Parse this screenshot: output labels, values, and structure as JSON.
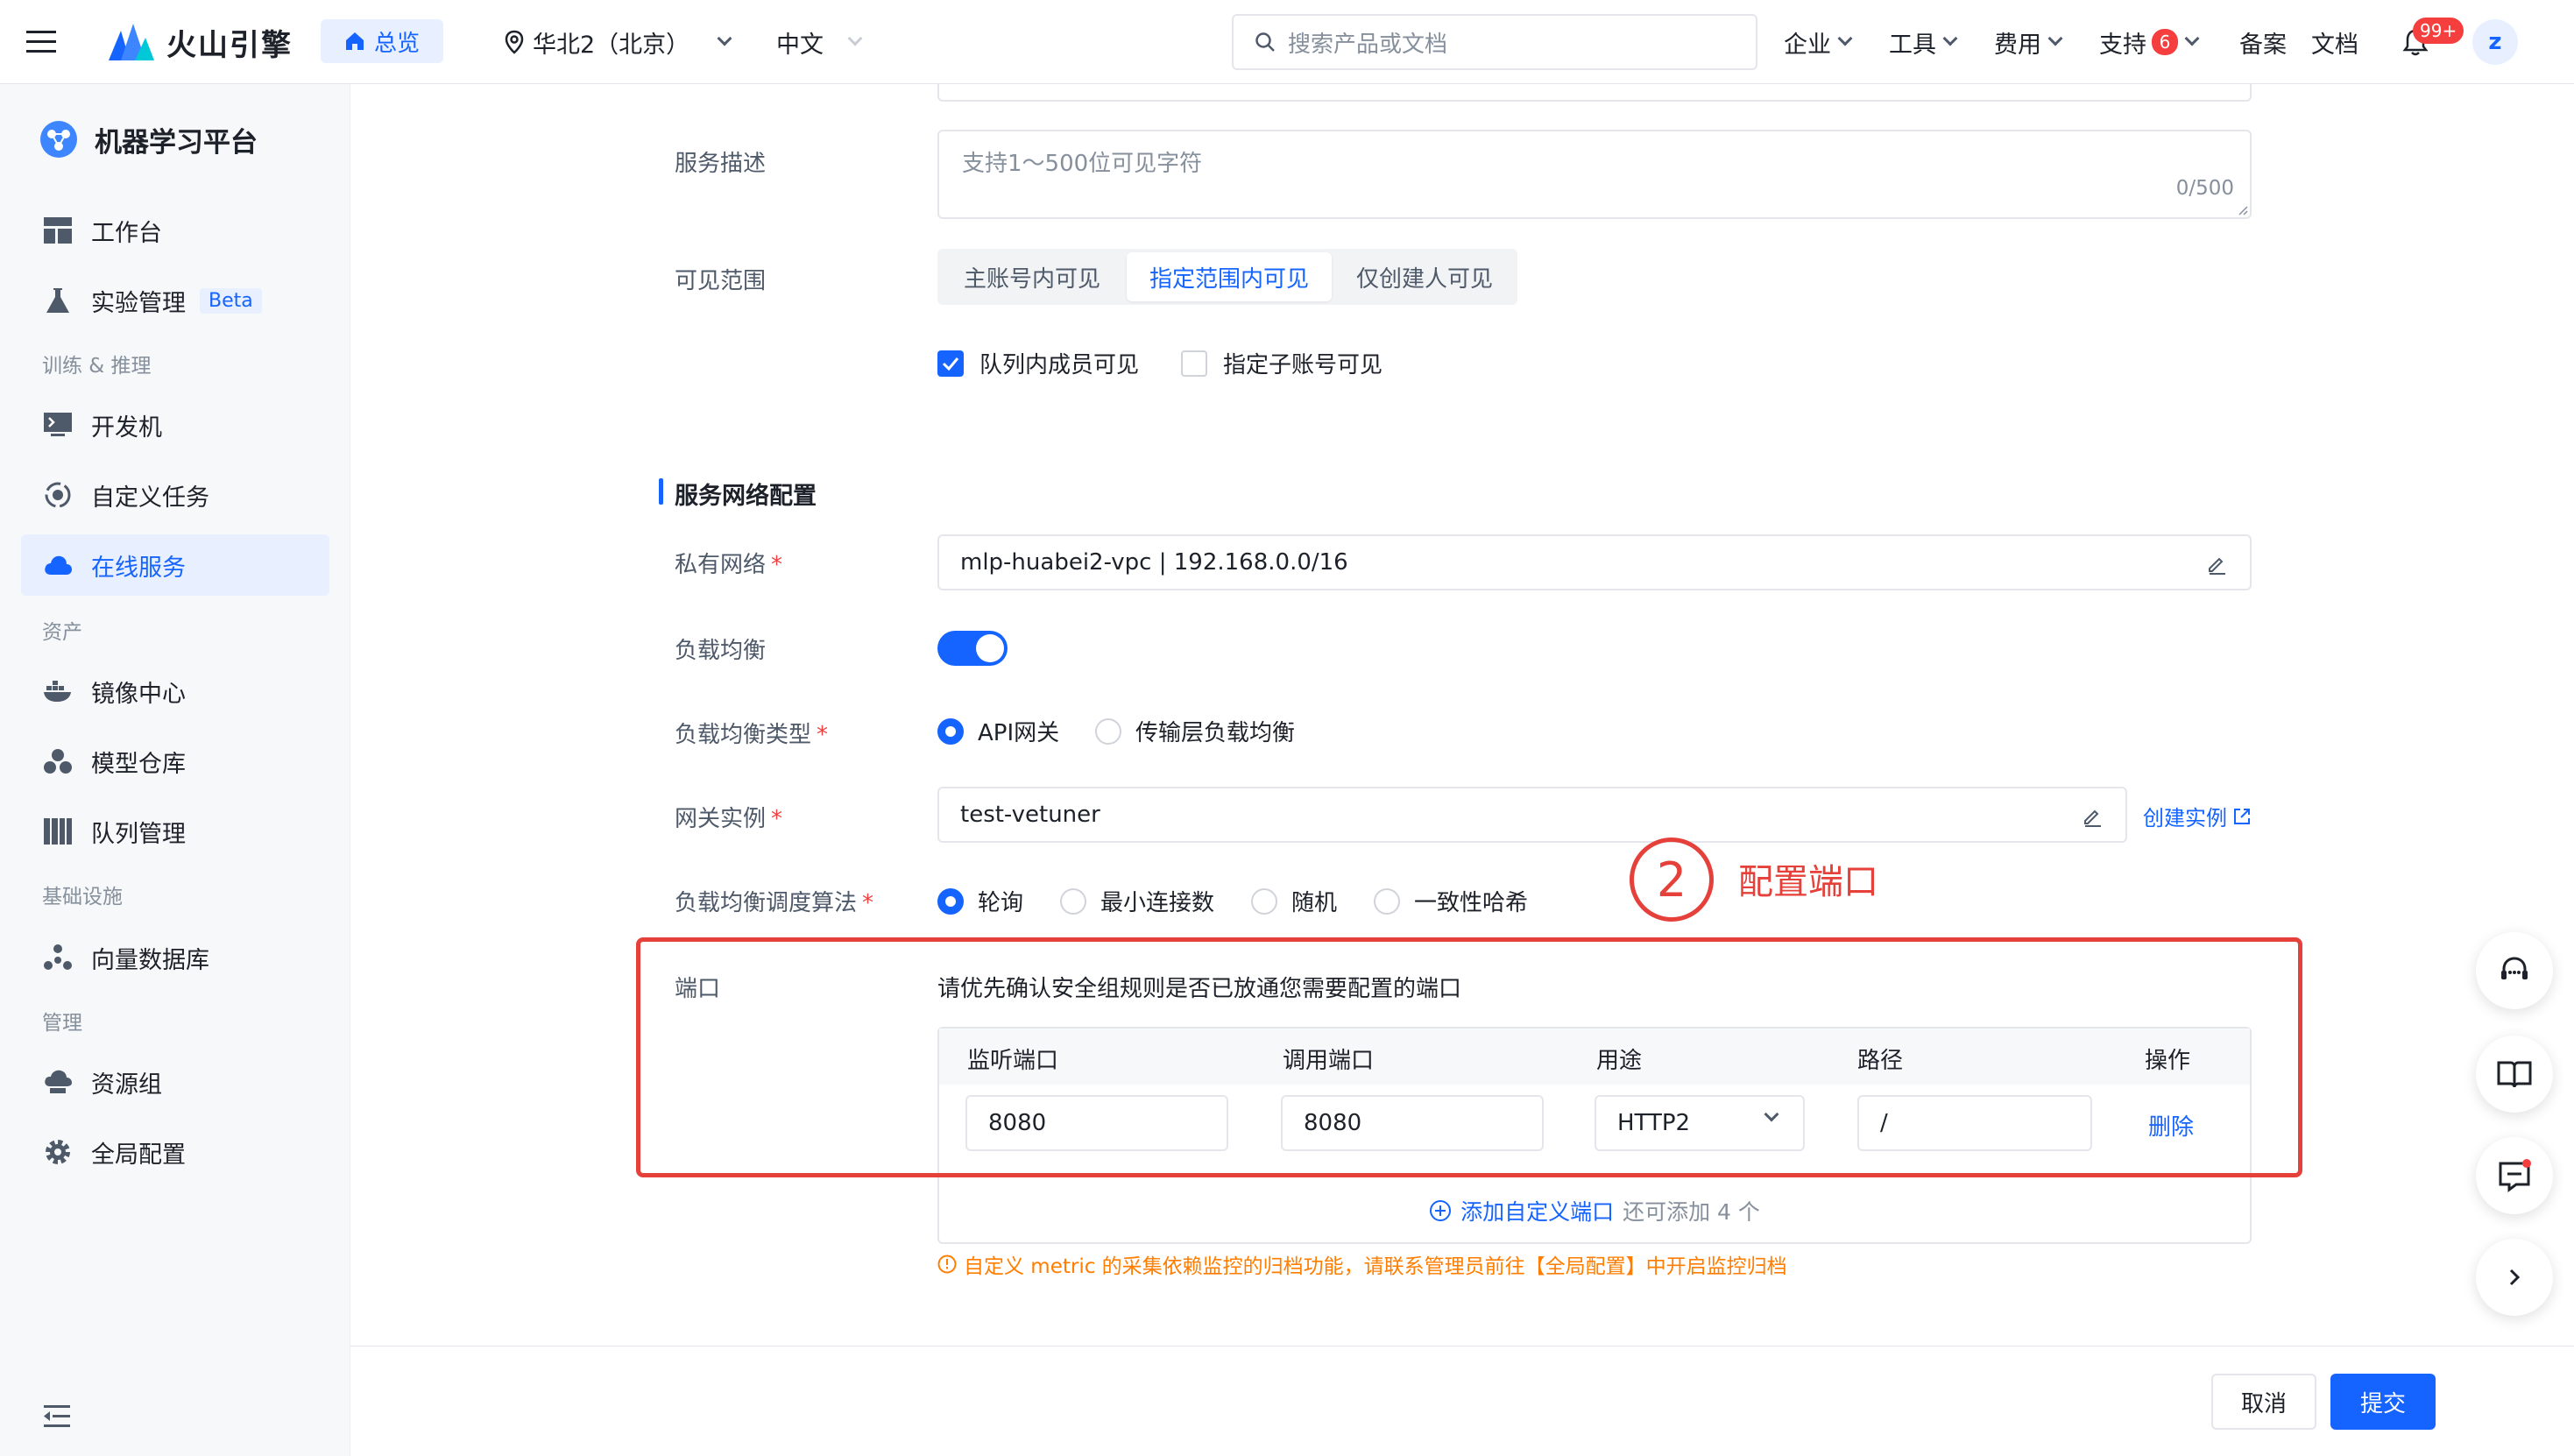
{
  "header": {
    "brand": "火山引擎",
    "overview_label": "总览",
    "region": "华北2（北京）",
    "language": "中文",
    "search_placeholder": "搜索产品或文档",
    "nav": {
      "enterprise": "企业",
      "tools": "工具",
      "billing": "费用",
      "support": "支持",
      "support_badge": "6",
      "filing": "备案",
      "docs": "文档"
    },
    "notification_badge": "99+",
    "avatar": "z"
  },
  "sidebar": {
    "title": "机器学习平台",
    "items": {
      "workbench": "工作台",
      "experiments": "实验管理",
      "experiments_badge": "Beta",
      "group_train": "训练 & 推理",
      "devmachine": "开发机",
      "custom_task": "自定义任务",
      "online_service": "在线服务",
      "group_assets": "资产",
      "image_center": "镜像中心",
      "model_repo": "模型仓库",
      "queue_mgmt": "队列管理",
      "group_infra": "基础设施",
      "vector_db": "向量数据库",
      "group_admin": "管理",
      "resource_group": "资源组",
      "global_config": "全局配置"
    }
  },
  "form": {
    "description": {
      "label": "服务描述",
      "placeholder": "支持1～500位可见字符",
      "counter": "0/500"
    },
    "visibility": {
      "label": "可见范围",
      "options": [
        "主账号内可见",
        "指定范围内可见",
        "仅创建人可见"
      ],
      "selected": "指定范围内可见",
      "check_queue": "队列内成员可见",
      "check_subaccount": "指定子账号可见"
    },
    "network_section_title": "服务网络配置",
    "vpc": {
      "label": "私有网络",
      "value": "mlp-huabei2-vpc | 192.168.0.0/16"
    },
    "lb": {
      "label": "负载均衡",
      "enabled": true
    },
    "lb_type": {
      "label": "负载均衡类型",
      "options": [
        "API网关",
        "传输层负载均衡"
      ],
      "selected": "API网关"
    },
    "gateway": {
      "label": "网关实例",
      "value": "test-vetuner",
      "create_link": "创建实例"
    },
    "algorithm": {
      "label": "负载均衡调度算法",
      "options": [
        "轮询",
        "最小连接数",
        "随机",
        "一致性哈希"
      ],
      "selected": "轮询"
    },
    "annotation": {
      "number": "2",
      "text": "配置端口"
    },
    "ports": {
      "label": "端口",
      "hint": "请优先确认安全组规则是否已放通您需要配置的端口",
      "columns": [
        "监听端口",
        "调用端口",
        "用途",
        "路径",
        "操作"
      ],
      "rows": [
        {
          "listen": "8080",
          "call": "8080",
          "usage": "HTTP2",
          "path": "/",
          "action": "删除"
        }
      ],
      "add_label": "添加自定义端口",
      "add_remaining": "还可添加 4 个"
    },
    "metric_notice": "自定义 metric 的采集依赖监控的归档功能，请联系管理员前往【全局配置】中开启监控归档"
  },
  "footer": {
    "cancel": "取消",
    "submit": "提交"
  },
  "colors": {
    "primary": "#1664ff",
    "annotation_red": "#e5403a",
    "warning": "#ff7d00"
  }
}
